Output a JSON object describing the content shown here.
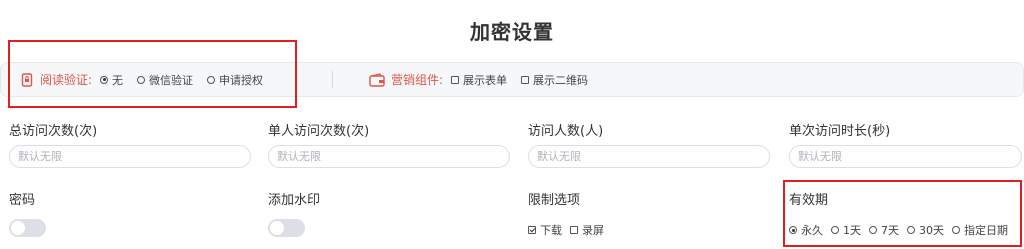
{
  "page": {
    "title": "加密设置"
  },
  "settings_bar": {
    "read_verify": {
      "label": "阅读验证:",
      "options": [
        "无",
        "微信验证",
        "申请授权"
      ],
      "selected": "无"
    },
    "marketing": {
      "label": "营销组件:",
      "options": [
        "展示表单",
        "展示二维码"
      ],
      "checked": []
    }
  },
  "fields": {
    "total_visits": {
      "label": "总访问次数(次)",
      "placeholder": "默认无限"
    },
    "per_user_visits": {
      "label": "单人访问次数(次)",
      "placeholder": "默认无限"
    },
    "visitor_count": {
      "label": "访问人数(人)",
      "placeholder": "默认无限"
    },
    "single_duration": {
      "label": "单次访问时长(秒)",
      "placeholder": "默认无限"
    },
    "password": {
      "label": "密码",
      "enabled": false
    },
    "watermark": {
      "label": "添加水印",
      "enabled": false
    },
    "restrictions": {
      "label": "限制选项",
      "options": [
        "下载",
        "录屏"
      ],
      "checked": [
        "下载"
      ]
    },
    "validity": {
      "label": "有效期",
      "options": [
        "永久",
        "1天",
        "7天",
        "30天",
        "指定日期"
      ],
      "selected": "永久"
    }
  },
  "colors": {
    "accent_red": "#e0564a",
    "highlight_box": "#e02020",
    "toggle_off": "#dcdfe6"
  },
  "icons": {
    "read_verify": "phone-lock-icon",
    "marketing": "wallet-icon"
  }
}
